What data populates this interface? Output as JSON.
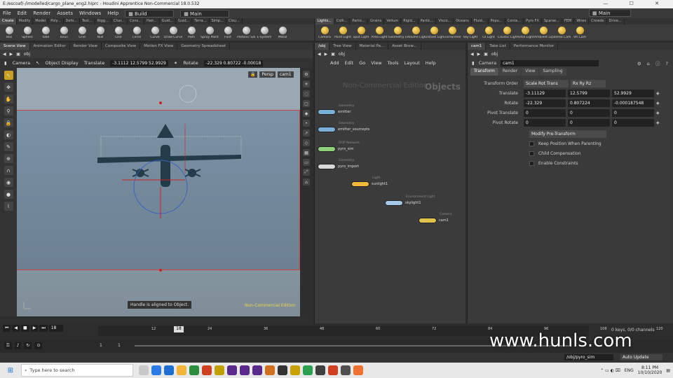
{
  "window": {
    "title": "E:/escoaf/-/imodelled/cargo_plane_eng2.hiprc - Houdini Apprentice Non-Commercial 18.0.532"
  },
  "menubar": {
    "items": [
      "File",
      "Edit",
      "Render",
      "Assets",
      "Windows",
      "Help"
    ],
    "build_label": "Build",
    "desktop_label": "Main",
    "desktop_right": "Main"
  },
  "shelf_left": {
    "tabs": [
      "Create",
      "Modify",
      "Model",
      "Poly...",
      "Defo...",
      "Text...",
      "Rigg...",
      "Char...",
      "Cons...",
      "Hair...",
      "Guid...",
      "Guid...",
      "Terra...",
      "Simp...",
      "Clou..."
    ],
    "tools": [
      "Box",
      "Sphere",
      "Tube",
      "Torus",
      "Grid",
      "Null",
      "Line",
      "Circle",
      "Curve",
      "Draw Curve",
      "Path",
      "Spray Paint",
      "Font",
      "Platonic Solids",
      "L-System",
      "Metal"
    ]
  },
  "shelf_right": {
    "tabs": [
      "Lights...",
      "Colli...",
      "Partic...",
      "Grains",
      "Vellum",
      "Rigid...",
      "Partic...",
      "Visco...",
      "Oceans",
      "Fluid...",
      "Popu...",
      "Conta...",
      "Pyro FX",
      "Sparse...",
      "FEM",
      "Wires",
      "Crowds",
      "Drive..."
    ],
    "tools": [
      "Camera",
      "Point Light",
      "Spot Light",
      "Area Light",
      "Geometry Light",
      "Volume Light",
      "Distant Light",
      "Environment Light",
      "Sky Light",
      "GI Light",
      "Caustic Light",
      "Portal Light",
      "Ambient Light",
      "Stereo Camera",
      "VR Cam"
    ]
  },
  "viewer_tabs": [
    "Scene View",
    "Animation Editor",
    "Render View",
    "Composite View",
    "Motion FX View",
    "Geometry Spreadsheet"
  ],
  "viewer_path": "obj",
  "viewer_toolbar": {
    "camera": "Camera",
    "display": "Object Display",
    "translate_label": "Translate",
    "translate": "-3.1112 12.5799 52.9929",
    "rotate_label": "Rotate",
    "rotate": "-22.329 0.80722 -0.00018"
  },
  "viewport": {
    "persp": "Persp",
    "cam": "cam1",
    "handle_msg": "Handle is aligned to Object.",
    "edition": "Non-Commercial Edition"
  },
  "network_tabs": [
    "/obj",
    "Tree View",
    "Material Pa...",
    "Asset Brow..."
  ],
  "network_path": "obj",
  "network_menu": [
    "Add",
    "Edit",
    "Go",
    "View",
    "Tools",
    "Layout",
    "Help"
  ],
  "network_watermark": "Non-Commercial Edition",
  "network_title": "Objects",
  "nodes": [
    {
      "name": "emitter",
      "sub": "Geometry",
      "color": "#7ab0d8"
    },
    {
      "name": "emitter_sourcepts",
      "sub": "Geometry",
      "color": "#7ab0d8"
    },
    {
      "name": "pyro_sim",
      "sub": "DOP Network",
      "color": "#8fd07a"
    },
    {
      "name": "pyro_import",
      "sub": "Geometry",
      "color": "#d8d8d8"
    },
    {
      "name": "sunlight1",
      "sub": "Light",
      "color": "#f2b83a"
    },
    {
      "name": "skylight1",
      "sub": "Environment Light",
      "color": "#a6c8e8"
    },
    {
      "name": "cam1",
      "sub": "Camera",
      "color": "#e0c24a"
    }
  ],
  "param_tabs": [
    "cam1",
    "Take List",
    "Performance Monitor"
  ],
  "param_path": "obj",
  "param_header": {
    "type": "Camera",
    "name": "cam1"
  },
  "param_subtabs": [
    "Transform",
    "Render",
    "View",
    "Sampling"
  ],
  "params": {
    "transform_order_label": "Transform Order",
    "transform_order": "Scale Rot Trans",
    "rot_order": "Rx Ry Rz",
    "rows": [
      {
        "label": "Translate",
        "v": [
          "-3.11129",
          "12.5799",
          "52.9929"
        ]
      },
      {
        "label": "Rotate",
        "v": [
          "-22.329",
          "0.807224",
          "-0.000187548"
        ]
      },
      {
        "label": "Pivot Translate",
        "v": [
          "0",
          "0",
          "0"
        ]
      },
      {
        "label": "Pivot Rotate",
        "v": [
          "0",
          "0",
          "0"
        ]
      }
    ],
    "modify_btn": "Modify Pre-Transform",
    "checks": [
      "Keep Position When Parenting",
      "Child Compensation",
      "Enable Constraints"
    ]
  },
  "timeline": {
    "ticks": [
      "12",
      "24",
      "36",
      "48",
      "60",
      "72",
      "84",
      "96",
      "108",
      "120"
    ],
    "current": "18",
    "frame_field": "18",
    "start": "1",
    "end": "1",
    "keys_label": "0 keys, 0/0 channels",
    "path": "/obj/pyro_sim",
    "auto_update": "Auto Update"
  },
  "watermark": "www.hunls.com",
  "taskbar": {
    "search": "Type here to search",
    "lang": "ENG",
    "time": "8:11 PM",
    "date": "10/10/2020"
  }
}
